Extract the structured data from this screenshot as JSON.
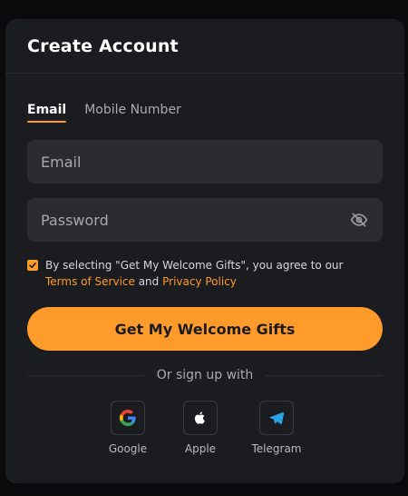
{
  "modal": {
    "title": "Create Account"
  },
  "tabs": [
    {
      "label": "Email",
      "active": true
    },
    {
      "label": "Mobile Number",
      "active": false
    }
  ],
  "form": {
    "email_placeholder": "Email",
    "email_value": "",
    "password_placeholder": "Password",
    "password_value": "",
    "password_toggle_icon": "eye-off-icon"
  },
  "agreement": {
    "checked": true,
    "text_before": "By selecting \"Get My Welcome Gifts\", you agree to our ",
    "terms_label": "Terms of Service",
    "text_middle": " and ",
    "privacy_label": "Privacy Policy"
  },
  "submit": {
    "label": "Get My Welcome Gifts"
  },
  "divider": {
    "label": "Or sign up with"
  },
  "socials": [
    {
      "label": "Google",
      "icon": "google-icon"
    },
    {
      "label": "Apple",
      "icon": "apple-icon"
    },
    {
      "label": "Telegram",
      "icon": "telegram-icon"
    }
  ],
  "colors": {
    "accent": "#ff9b2b",
    "background": "#1b1c20",
    "input_background": "#2a2b31"
  }
}
